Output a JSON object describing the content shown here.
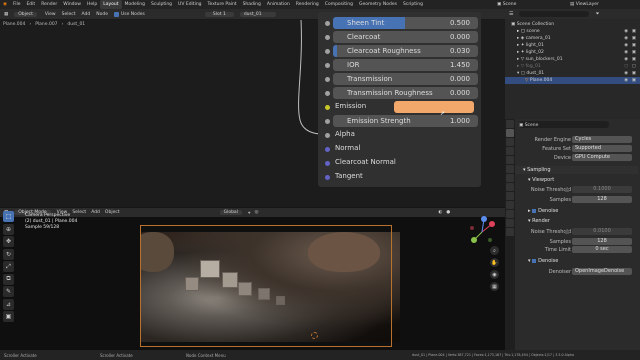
{
  "menu": {
    "items": [
      "File",
      "Edit",
      "Render",
      "Window",
      "Help"
    ],
    "workspaces": [
      "Layout",
      "Modeling",
      "Sculpting",
      "UV Editing",
      "Texture Paint",
      "Shading",
      "Animation",
      "Rendering",
      "Compositing",
      "Geometry Nodes",
      "Scripting"
    ],
    "active_workspace": "Layout",
    "scene": "Scene",
    "view_layer": "ViewLayer"
  },
  "node_editor": {
    "type": "Object",
    "menus": [
      "View",
      "Select",
      "Add",
      "Node"
    ],
    "use_nodes_label": "Use Nodes",
    "slot": "Slot 1",
    "material": "dust_01",
    "breadcrumb": [
      "Plane.004",
      "Plane.007",
      "dust_01"
    ],
    "properties": [
      {
        "label": "Sheen Tint",
        "value": "0.500",
        "fill": 0.5
      },
      {
        "label": "Clearcoat",
        "value": "0.000",
        "fill": 0
      },
      {
        "label": "Clearcoat Roughness",
        "value": "0.030",
        "fill": 0.03
      },
      {
        "label": "IOR",
        "value": "1.450",
        "fill": 0
      },
      {
        "label": "Transmission",
        "value": "0.000",
        "fill": 0
      },
      {
        "label": "Transmission Roughness",
        "value": "0.000",
        "fill": 0
      }
    ],
    "emission_label": "Emission",
    "emission_color": "#f2a86a",
    "emission_strength_label": "Emission Strength",
    "emission_strength_value": "1.000",
    "outputs": [
      "Alpha",
      "Normal",
      "Clearcoat Normal",
      "Tangent"
    ]
  },
  "viewport": {
    "mode": "Object Mode",
    "menus": [
      "View",
      "Select",
      "Add",
      "Object"
    ],
    "transform": "Global",
    "info_line1": "Camera Perspective",
    "info_line2": "(2) dust_01 | Plane.004",
    "info_line3": "Sample 59/128"
  },
  "outliner": {
    "title": "Scene Collection",
    "rows": [
      "scene",
      "camera_01",
      "light_01",
      "light_02",
      "sun_blockers_01",
      "fog_01",
      "dust_01",
      "Plane.004"
    ],
    "selected": "Plane.004"
  },
  "properties": {
    "scene_label": "Scene",
    "render_engine_label": "Render Engine",
    "render_engine": "Cycles",
    "feature_set_label": "Feature Set",
    "feature_set": "Supported",
    "device_label": "Device",
    "device": "GPU Compute",
    "sampling_label": "Sampling",
    "viewport_label": "Viewport",
    "noise_threshold_label": "Noise Threshold",
    "viewport_noise_threshold": "0.1000",
    "samples_label": "Samples",
    "viewport_samples": "128",
    "denoise_label": "Denoise",
    "render_label": "Render",
    "render_noise_threshold": "0.0100",
    "render_samples": "128",
    "time_limit_label": "Time Limit",
    "time_limit": "0 sec",
    "denoiser_label": "Denoiser",
    "denoiser": "OpenImageDenoise"
  },
  "status": {
    "left1": "Scroller Activate",
    "left2": "Scroller Activate",
    "middle": "Node Context Menu",
    "right": "dust_01 | Plane.004 | Verts:387,721 | Faces:1,173,167 | Tris:1,178,494 | Objects:1/17 | 3.5.0 Alpha"
  },
  "colors": {
    "accent": "#4772b3",
    "emission": "#f2a86a",
    "camera_frame": "#b9712e"
  }
}
